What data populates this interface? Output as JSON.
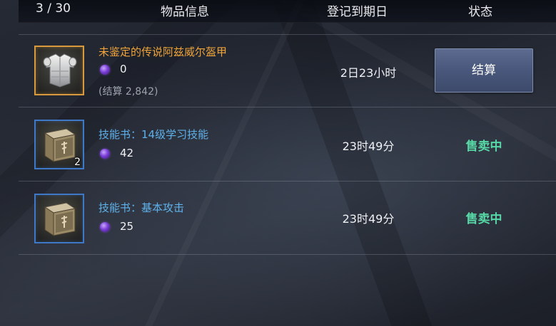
{
  "header": {
    "count": "3 / 30",
    "col_item_info": "物品信息",
    "col_expiry": "登记到期日",
    "col_status": "状态"
  },
  "items": [
    {
      "name": "未鉴定的传说阿兹威尔盔甲",
      "icon": "armor-chestplate-icon",
      "price": "0",
      "settlement": "(结算 2,842)",
      "expiry": "2日23小时",
      "action_label": "结算",
      "rarity_color": "#f0a43a"
    },
    {
      "name": "技能书：14级学习技能",
      "icon": "skill-book-icon",
      "quantity": "2",
      "price": "42",
      "expiry": "23时49分",
      "status": "售卖中",
      "rarity_color": "#5fb1ea"
    },
    {
      "name": "技能书：基本攻击",
      "icon": "skill-book-icon",
      "price": "25",
      "expiry": "23时49分",
      "status": "售卖中",
      "rarity_color": "#5fb1ea"
    }
  ],
  "colors": {
    "status_selling": "#57d7a6",
    "legendary_border": "#d89a3c",
    "skill_border": "#3f78c7",
    "currency_gem": "#7a3fd6"
  }
}
